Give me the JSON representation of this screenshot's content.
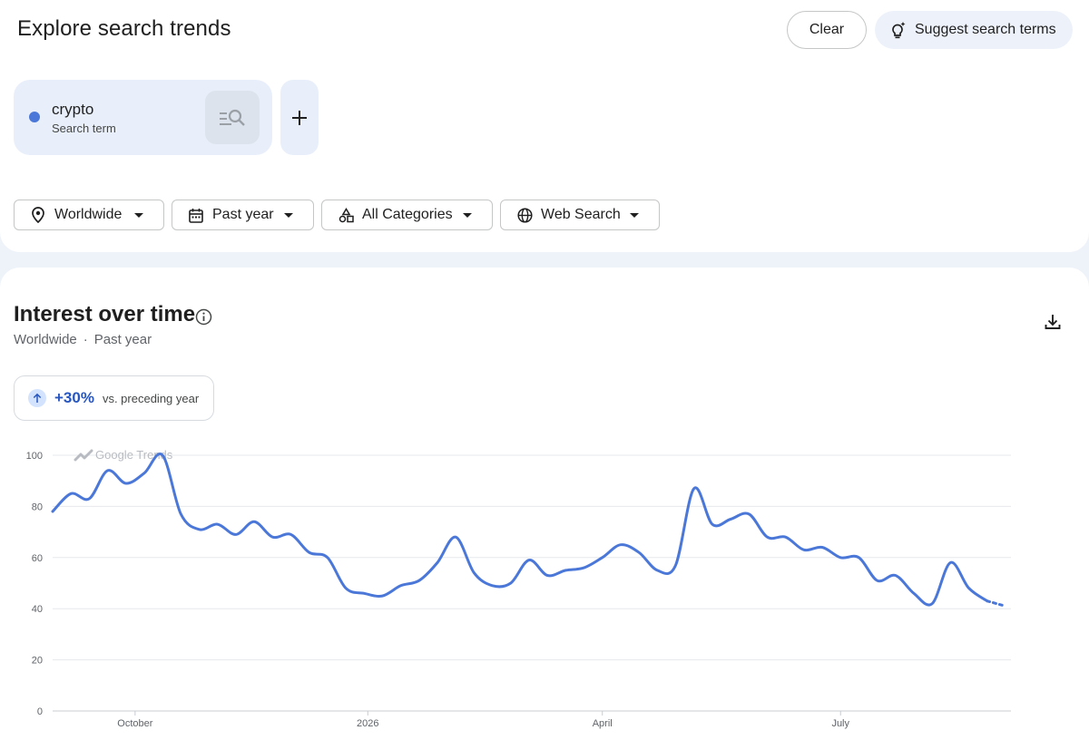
{
  "header": {
    "title": "Explore search trends",
    "clear_label": "Clear",
    "suggest_label": "Suggest search terms"
  },
  "term": {
    "name": "crypto",
    "type": "Search term",
    "dot_color": "#4b78d8"
  },
  "filters": [
    {
      "label": "Worldwide",
      "icon": "location-pin-icon"
    },
    {
      "label": "Past year",
      "icon": "calendar-icon"
    },
    {
      "label": "All Categories",
      "icon": "categories-icon"
    },
    {
      "label": "Web Search",
      "icon": "globe-icon"
    }
  ],
  "section": {
    "title": "Interest over time",
    "region": "Worldwide",
    "separator": "·",
    "period": "Past year"
  },
  "change": {
    "value": "+30%",
    "label": "vs. preceding year"
  },
  "chart_data": {
    "type": "line",
    "watermark": "Google Trends",
    "ylim": [
      0,
      100
    ],
    "yticks": [
      0,
      20,
      40,
      60,
      80,
      100
    ],
    "xlim": [
      0,
      52.3
    ],
    "xticks": [
      {
        "label": "October",
        "x": 4.5
      },
      {
        "label": "2026",
        "x": 17.2
      },
      {
        "label": "April",
        "x": 30.0
      },
      {
        "label": "July",
        "x": 43.0
      }
    ],
    "grid": true,
    "series": [
      {
        "color": "#4b78d8",
        "x": [
          0,
          1,
          2,
          3,
          4,
          5,
          6,
          7,
          8,
          9,
          10,
          11,
          12,
          13,
          14,
          15,
          16,
          17,
          18,
          19,
          20,
          21,
          22,
          23,
          24,
          25,
          26,
          27,
          28,
          29,
          30,
          31,
          32,
          33,
          34,
          35,
          36,
          37,
          38,
          39,
          40,
          41,
          42,
          43,
          44,
          45,
          46,
          47,
          48,
          49,
          50,
          51,
          52
        ],
        "values": [
          78,
          85,
          83,
          94,
          89,
          93,
          100,
          77,
          71,
          73,
          69,
          74,
          68,
          69,
          62,
          60,
          48,
          46,
          45,
          49,
          51,
          58,
          68,
          54,
          49,
          50,
          59,
          53,
          55,
          56,
          60,
          65,
          62,
          55,
          57,
          87,
          73,
          75,
          77,
          68,
          68,
          63,
          64,
          60,
          60,
          51,
          53,
          46,
          42,
          58,
          48,
          43,
          41
        ],
        "partial_from_index": 51
      }
    ]
  }
}
